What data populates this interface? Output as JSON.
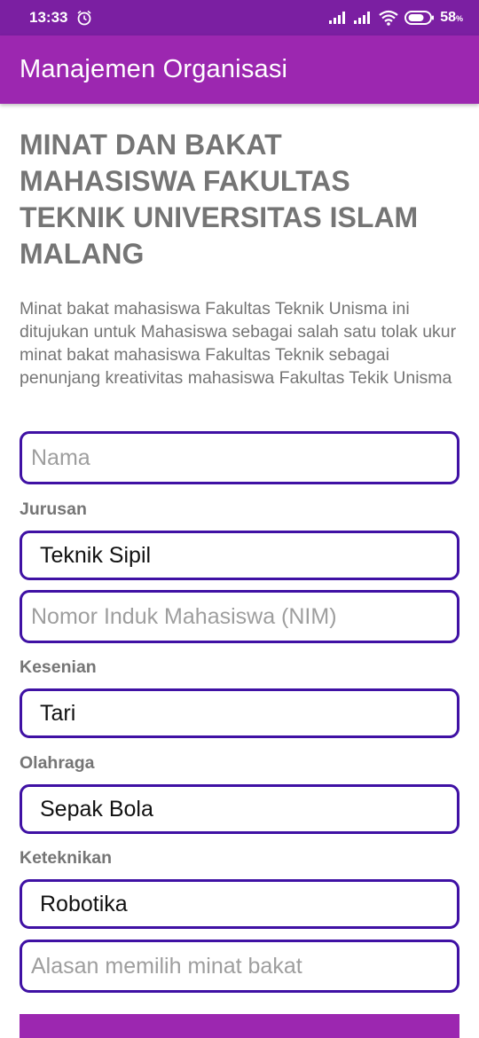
{
  "status_bar": {
    "time": "13:33",
    "battery_percent": "58",
    "battery_unit": "%"
  },
  "app_bar": {
    "title": "Manajemen Organisasi"
  },
  "form": {
    "title": "MINAT DAN BAKAT MAHASISWA FAKULTAS TEKNIK UNIVERSITAS ISLAM MALANG",
    "description": "Minat bakat mahasiswa Fakultas Teknik Unisma ini ditujukan untuk Mahasiswa sebagai salah satu tolak ukur minat bakat mahasiswa Fakultas Teknik sebagai penunjang kreativitas mahasiswa Fakultas Tekik Unisma",
    "nama_placeholder": "Nama",
    "jurusan_label": "Jurusan",
    "jurusan_value": "Teknik Sipil",
    "nim_placeholder": "Nomor Induk Mahasiswa (NIM)",
    "kesenian_label": "Kesenian",
    "kesenian_value": "Tari",
    "olahraga_label": "Olahraga",
    "olahraga_value": "Sepak Bola",
    "keteknikan_label": "Keteknikan",
    "keteknikan_value": "Robotika",
    "alasan_placeholder": "Alasan memilih minat bakat"
  },
  "colors": {
    "status_bar": "#7b1fa2",
    "app_bar": "#9c27b0",
    "field_border": "#3f11a4",
    "label_text": "#757575"
  },
  "icons": {
    "alarm": "alarm-icon",
    "signal": "signal-icon",
    "wifi": "wifi-icon",
    "battery": "battery-icon"
  }
}
